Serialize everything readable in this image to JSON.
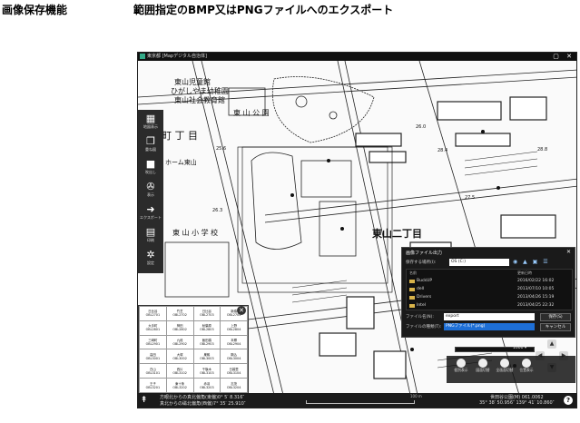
{
  "header": {
    "feature_label": "画像保存機能",
    "feature_desc": "範囲指定のBMP又はPNGファイルへのエクスポート"
  },
  "window": {
    "title": "東京都 [Mapデジタル自治体]",
    "controls": "▢ ✕"
  },
  "map": {
    "labels": {
      "kindergarten1": "ひがしやま幼稚園",
      "kindergarten2": "東山児童館",
      "board": "東山社会教育館",
      "park": "東 山 公 園",
      "chome_left": "町 丁 目",
      "home": "ホーム東山",
      "school": "東 山 小 学 校",
      "district": "東山二丁目",
      "elev1": "25.6",
      "elev2": "26.0",
      "elev3": "28.4",
      "elev4": "27.5",
      "elev5": "26.3",
      "elev6": "28.8"
    }
  },
  "toolbar": {
    "items": [
      {
        "icon": "grid-icon",
        "label": "地図表示"
      },
      {
        "icon": "layers-icon",
        "label": "重ね図"
      },
      {
        "icon": "chat-icon",
        "label": "吹出し"
      },
      {
        "icon": "gear-wheel-icon",
        "label": "表示"
      },
      {
        "icon": "export-icon",
        "label": "エクスポート"
      },
      {
        "icon": "print-icon",
        "label": "印刷"
      },
      {
        "icon": "settings-icon",
        "label": "設定"
      }
    ]
  },
  "grid_panel": {
    "rows": [
      [
        "日比谷",
        "OBL2701",
        "竹芝",
        "OBL2702",
        "日比谷",
        "OBL2703",
        "新橋",
        "OBL2704"
      ],
      [
        "大手町",
        "OBL2801",
        "神田",
        "OBL2802",
        "秋葉原",
        "OBL2803",
        "上野",
        "OBL2804"
      ],
      [
        "三崎町",
        "OBL2901",
        "九段",
        "OBL2902",
        "飯田橋",
        "OBL2903",
        "本郷",
        "OBL2904"
      ],
      [
        "高田",
        "OBL3001",
        "大塚",
        "OBL3002",
        "巣鴨",
        "OBL3003",
        "駒込",
        "OBL3004"
      ],
      [
        "白山",
        "OBL3101",
        "西片",
        "OBL3102",
        "千駄木",
        "OBL3103",
        "日暮里",
        "OBL3104"
      ],
      [
        "王子",
        "OBL3201",
        "東十条",
        "OBL3202",
        "赤羽",
        "OBL3203",
        "志茂",
        "OBL3204"
      ]
    ]
  },
  "dialog": {
    "title": "画像ファイル出力",
    "location_label": "保存する場所(I):",
    "location_value": "OS (C:)",
    "header_name": "名前",
    "header_date": "更新日時",
    "items": [
      {
        "name": "BuckUP",
        "date": "2016/02/22 16:02"
      },
      {
        "name": "dell",
        "date": "2013/07/10 10:05"
      },
      {
        "name": "Drivers",
        "date": "2013/04/26 15:19"
      },
      {
        "name": "Intel",
        "date": "2013/04/25 22:32"
      }
    ],
    "filename_label": "ファイル名(N):",
    "filename_value": "export",
    "filetype_label": "ファイルの種類(T):",
    "filetype_value": "PNGファイル(*.png)",
    "save_label": "保存(S)",
    "cancel_label": "キャンセル"
  },
  "scale": {
    "value": "1000"
  },
  "bottom_panel": {
    "buttons": [
      "個別表示",
      "図面切替",
      "全画面切替",
      "位置表示"
    ]
  },
  "statusbar": {
    "line1": "方眼北からの真北偏角(東偏)0° 5′ 8.316″",
    "line2": "真北からの磁北偏角(西偏)7° 35′ 25.910″",
    "ruler_label": "100 m",
    "coord1": "世田谷公園(M) 061.0062",
    "coord2": "35° 38′ 50.956″  139° 41′ 10.860″",
    "help": "?"
  }
}
